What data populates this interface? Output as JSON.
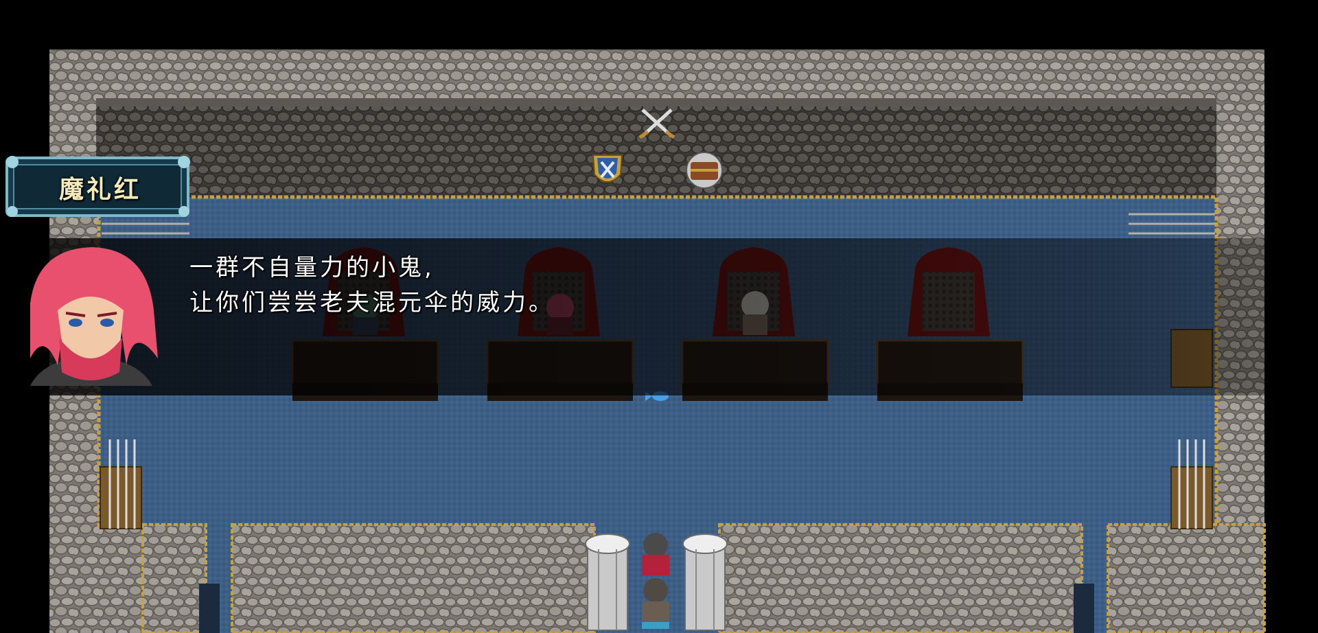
{
  "scene": {
    "location": "throne-hall",
    "colors": {
      "background": "#000000",
      "cobble": "#8a8580",
      "carpet": "#3e5f88",
      "carpet_border": "#c7a040",
      "table": "#2a1f17",
      "throne": "#7a1414"
    },
    "icons": [
      "crossed-swords-icon",
      "shield-icon",
      "treasure-barrel-icon",
      "spear-rack-icon",
      "fish-icon",
      "pillar-icon",
      "throne-icon"
    ]
  },
  "dialogue": {
    "speaker": "魔礼红",
    "lines": [
      "一群不自量力的小鬼,",
      "让你们尝尝老夫混元伞的威力。"
    ]
  }
}
